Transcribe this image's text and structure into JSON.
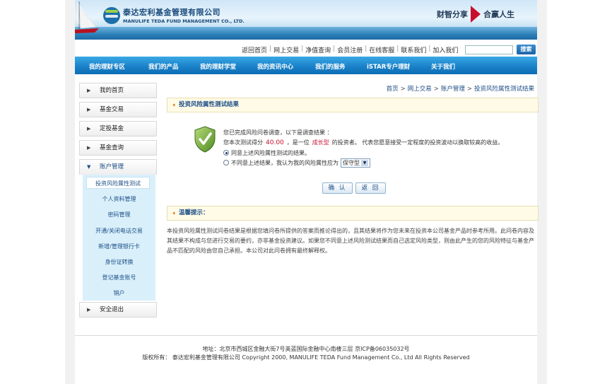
{
  "header": {
    "logo_cn": "泰达宏利基金管理有限公司",
    "logo_en": "MANULIFE TEDA FUND MANAGEMENT CO., LTD.",
    "slogan_left": "财智分享",
    "slogan_right": "合赢人生"
  },
  "toplinks": [
    "返回首页",
    "网上交易",
    "净值查询",
    "会员注册",
    "在线客服",
    "联系我们",
    "加入我们"
  ],
  "search": {
    "button_label": "搜索",
    "placeholder": ""
  },
  "nav": [
    "我的理财专区",
    "我们的产品",
    "我的理财学堂",
    "我的资讯中心",
    "我们的服务",
    "iSTAR专户理财",
    "关于我们"
  ],
  "sidebar": {
    "items": [
      "我的首页",
      "基金交易",
      "定投基金",
      "基金查询",
      "账户管理",
      "安全退出"
    ],
    "submenu": [
      "投资风险属性测试",
      "个人资料管理",
      "密码管理",
      "开通/关闭电话交易",
      "新增/管理银行卡",
      "身份证转换",
      "登记基金账号",
      "销户"
    ]
  },
  "breadcrumb": [
    "首页",
    "网上交易",
    "账户管理",
    "投资风险属性测试结果"
  ],
  "result": {
    "title": "投资风险属性测试结果",
    "line1": "您已完成风险问卷调查，以下是调查结果 ：",
    "line2_pre": "您本次测试得分",
    "score": "40.00",
    "line2_mid": "，是一位",
    "type": "成长型",
    "line2_post": "的投资者。 代表您愿意接受一定程度的投资波动以换取较高的收益。",
    "option_agree": "同意上述风险属性测试的结果。",
    "option_disagree": "不同意上述结果，我认为我的风险属性应为",
    "select_value": "保守型",
    "confirm_label": "确 认",
    "back_label": "返 回"
  },
  "tip": {
    "title": "温馨提示：",
    "text": "本投资风险属性测试问卷结果是根据您填问卷所提供的答案而推论得出的，且其结果将作为您未来在投资本公司基金产品时参考所用。此问卷内容及其结果不构成与您进行交易的要约，亦非基金投资建议。如果您不同意上述风险测试结果而自己选定风险类型，则由此产生的您的风险特征与基金产品不匹配的风险由您自己承担。本公司对此问卷拥有最终解释权。"
  },
  "footer": {
    "address": "地址：北京市西城区金融大街7号英蓝国际金融中心南楼三层 京ICP备06035032号",
    "copyright": "版权所有： 泰达宏利基金管理有限公司 Copyright 2000, MANULIFE TEDA Fund Management Co., Ltd All Rights Reserved"
  },
  "colors": {
    "nav_blue": "#1a82c9",
    "link_blue": "#1d4e86",
    "accent_red": "#c8102e",
    "panel_yellow": "#fffbe7",
    "submenu_bg": "#d9f0fb"
  }
}
